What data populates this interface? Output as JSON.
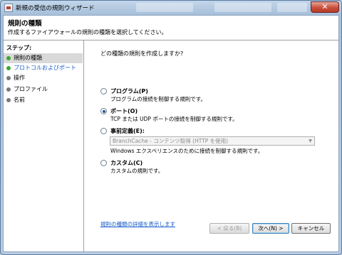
{
  "window": {
    "title": "新規の受信の規則ウィザード"
  },
  "header": {
    "title": "規則の種類",
    "description": "作成するファイアウォールの規則の種類を選択してください。"
  },
  "steps": {
    "heading": "ステップ:",
    "items": [
      {
        "label": "規則の種類",
        "state": "current",
        "dot_color": "#40a830"
      },
      {
        "label": "プロトコルおよびポート",
        "state": "link",
        "dot_color": "#40a830"
      },
      {
        "label": "操作",
        "state": "normal",
        "dot_color": "#7a7a7a"
      },
      {
        "label": "プロファイル",
        "state": "normal",
        "dot_color": "#7a7a7a"
      },
      {
        "label": "名前",
        "state": "normal",
        "dot_color": "#7a7a7a"
      }
    ]
  },
  "main": {
    "question": "どの種類の規則を作成しますか?",
    "options": [
      {
        "label": "プログラム(P)",
        "description": "プログラムの接続を制御する規則です。",
        "selected": false
      },
      {
        "label": "ポート(O)",
        "description": "TCP または UDP ポートの接続を制御する規則です。",
        "selected": true
      },
      {
        "label": "事前定義(E):",
        "description": "Windows エクスペリエンスのために接続を制御する規則です。",
        "selected": false,
        "dropdown_value": "BranchCache - コンテンツ取得 (HTTP を使用)"
      },
      {
        "label": "カスタム(C)",
        "description": "カスタムの規則です。",
        "selected": false
      }
    ],
    "more_link": "規則の種類の詳細を表示します"
  },
  "buttons": {
    "back": "< 戻る(B)",
    "next": "次へ(N) >",
    "cancel": "キャンセル"
  },
  "colors": {
    "accent": "#1a5cc8",
    "close": "#c9503c"
  }
}
